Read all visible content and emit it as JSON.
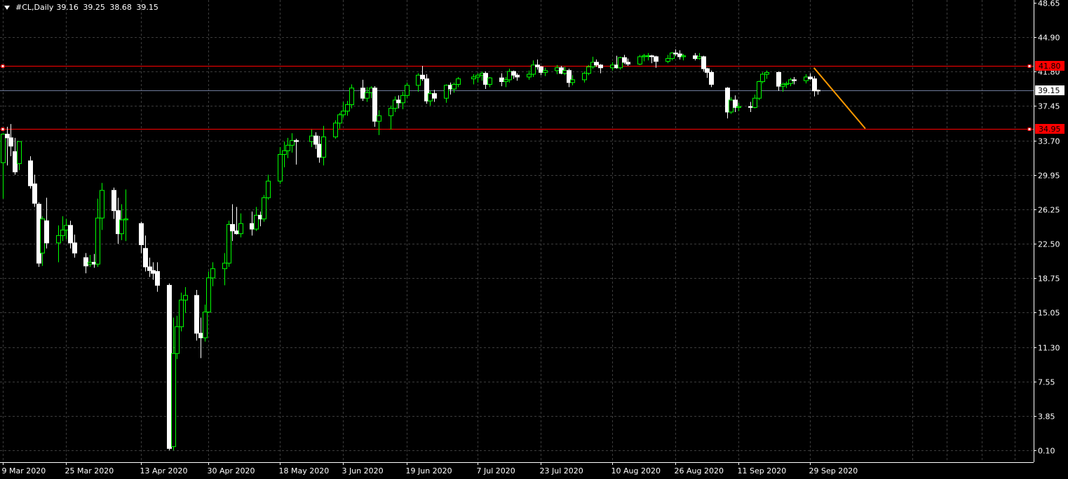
{
  "header": {
    "symbol": "#CL,Daily",
    "open": "39.16",
    "high": "39.25",
    "low": "38.68",
    "close": "39.15"
  },
  "colors": {
    "background": "#000000",
    "grid": "#3c3c3c",
    "axis": "#ffffff",
    "bull_body": "#000000",
    "bull_outline": "#00ff00",
    "bear_body": "#ffffff",
    "resistance_line": "#ff0000",
    "price_line": "#6e7a9a",
    "trend_line": "#ff9900"
  },
  "chart_data": {
    "type": "candlestick",
    "y_ticks": [
      "48.65",
      "44.90",
      "41.80",
      "37.45",
      "33.70",
      "29.95",
      "26.25",
      "22.50",
      "18.75",
      "15.05",
      "11.30",
      "7.55",
      "3.85",
      "0.10"
    ],
    "y_range": [
      0.1,
      48.65
    ],
    "x_labels": [
      "9 Mar 2020",
      "25 Mar 2020",
      "13 Apr 2020",
      "30 Apr 2020",
      "18 May 2020",
      "3 Jun 2020",
      "19 Jun 2020",
      "7 Jul 2020",
      "23 Jul 2020",
      "10 Aug 2020",
      "26 Aug 2020",
      "11 Sep 2020",
      "29 Sep 2020"
    ],
    "horizontal_lines": [
      {
        "value": 41.8,
        "label": "41.80",
        "color": "#ff0000"
      },
      {
        "value": 34.95,
        "label": "34.95",
        "color": "#ff0000"
      }
    ],
    "current_price": {
      "value": 39.15,
      "label": "39.15"
    },
    "trend_line": {
      "from_date": "30 Sep 2020",
      "from_value": 41.6,
      "to_date": "13 Oct 2020",
      "to_value": 35.0
    },
    "candles": [
      {
        "d": "9 Mar 2020",
        "o": 31.3,
        "h": 34.5,
        "l": 27.4,
        "c": 34.4
      },
      {
        "d": "10 Mar 2020",
        "o": 34.4,
        "h": 35.2,
        "l": 31.0,
        "c": 34.0
      },
      {
        "d": "11 Mar 2020",
        "o": 34.0,
        "h": 35.5,
        "l": 32.0,
        "c": 33.1
      },
      {
        "d": "12 Mar 2020",
        "o": 32.5,
        "h": 34.0,
        "l": 30.0,
        "c": 30.3
      },
      {
        "d": "13 Mar 2020",
        "o": 31.2,
        "h": 33.5,
        "l": 30.5,
        "c": 33.6
      },
      {
        "d": "16 Mar 2020",
        "o": 31.5,
        "h": 32.0,
        "l": 28.5,
        "c": 28.8
      },
      {
        "d": "17 Mar 2020",
        "o": 29.0,
        "h": 30.0,
        "l": 26.5,
        "c": 26.9
      },
      {
        "d": "18 Mar 2020",
        "o": 26.8,
        "h": 27.0,
        "l": 20.0,
        "c": 20.4
      },
      {
        "d": "19 Mar 2020",
        "o": 21.5,
        "h": 25.5,
        "l": 20.1,
        "c": 25.2
      },
      {
        "d": "20 Mar 2020",
        "o": 25.0,
        "h": 27.5,
        "l": 22.0,
        "c": 22.6
      },
      {
        "d": "23 Mar 2020",
        "o": 22.6,
        "h": 24.5,
        "l": 20.5,
        "c": 23.4
      },
      {
        "d": "24 Mar 2020",
        "o": 23.4,
        "h": 25.5,
        "l": 22.8,
        "c": 24.0
      },
      {
        "d": "25 Mar 2020",
        "o": 24.0,
        "h": 25.2,
        "l": 23.0,
        "c": 24.5
      },
      {
        "d": "26 Mar 2020",
        "o": 24.5,
        "h": 25.0,
        "l": 22.0,
        "c": 22.6
      },
      {
        "d": "27 Mar 2020",
        "o": 22.6,
        "h": 23.5,
        "l": 21.0,
        "c": 21.5
      },
      {
        "d": "30 Mar 2020",
        "o": 21.0,
        "h": 21.5,
        "l": 19.3,
        "c": 20.1
      },
      {
        "d": "31 Mar 2020",
        "o": 20.3,
        "h": 21.3,
        "l": 20.0,
        "c": 20.5
      },
      {
        "d": "1 Apr 2020",
        "o": 20.5,
        "h": 21.4,
        "l": 19.9,
        "c": 20.3
      },
      {
        "d": "2 Apr 2020",
        "o": 20.3,
        "h": 27.4,
        "l": 20.0,
        "c": 25.3
      },
      {
        "d": "3 Apr 2020",
        "o": 25.3,
        "h": 29.1,
        "l": 24.0,
        "c": 28.3
      },
      {
        "d": "6 Apr 2020",
        "o": 28.3,
        "h": 28.6,
        "l": 25.2,
        "c": 26.1
      },
      {
        "d": "7 Apr 2020",
        "o": 26.1,
        "h": 27.5,
        "l": 22.5,
        "c": 23.6
      },
      {
        "d": "8 Apr 2020",
        "o": 23.6,
        "h": 26.8,
        "l": 22.9,
        "c": 25.1
      },
      {
        "d": "9 Apr 2020",
        "o": 25.1,
        "h": 28.4,
        "l": 22.8,
        "c": 25.2
      },
      {
        "d": "13 Apr 2020",
        "o": 24.7,
        "h": 24.9,
        "l": 21.5,
        "c": 22.4
      },
      {
        "d": "14 Apr 2020",
        "o": 22.0,
        "h": 23.4,
        "l": 19.5,
        "c": 20.0
      },
      {
        "d": "15 Apr 2020",
        "o": 20.0,
        "h": 21.0,
        "l": 18.9,
        "c": 19.6
      },
      {
        "d": "16 Apr 2020",
        "o": 19.6,
        "h": 20.5,
        "l": 18.6,
        "c": 19.3
      },
      {
        "d": "17 Apr 2020",
        "o": 19.5,
        "h": 20.5,
        "l": 17.3,
        "c": 18.0
      },
      {
        "d": "20 Apr 2020",
        "o": 18.0,
        "h": 18.2,
        "l": 0.1,
        "c": 0.3
      },
      {
        "d": "21 Apr 2020",
        "o": 0.5,
        "h": 14.5,
        "l": 0.1,
        "c": 10.6
      },
      {
        "d": "22 Apr 2020",
        "o": 10.6,
        "h": 14.7,
        "l": 10.0,
        "c": 13.5
      },
      {
        "d": "23 Apr 2020",
        "o": 13.5,
        "h": 17.2,
        "l": 13.0,
        "c": 16.4
      },
      {
        "d": "24 Apr 2020",
        "o": 16.4,
        "h": 17.8,
        "l": 15.0,
        "c": 16.9
      },
      {
        "d": "27 Apr 2020",
        "o": 16.9,
        "h": 17.5,
        "l": 12.0,
        "c": 12.8
      },
      {
        "d": "28 Apr 2020",
        "o": 12.8,
        "h": 14.5,
        "l": 10.1,
        "c": 12.3
      },
      {
        "d": "29 Apr 2020",
        "o": 12.3,
        "h": 15.9,
        "l": 11.9,
        "c": 15.1
      },
      {
        "d": "30 Apr 2020",
        "o": 15.1,
        "h": 19.5,
        "l": 15.0,
        "c": 18.8
      },
      {
        "d": "1 May 2020",
        "o": 18.8,
        "h": 20.5,
        "l": 17.9,
        "c": 19.8
      },
      {
        "d": "4 May 2020",
        "o": 19.8,
        "h": 21.5,
        "l": 18.0,
        "c": 20.4
      },
      {
        "d": "5 May 2020",
        "o": 20.4,
        "h": 25.0,
        "l": 20.0,
        "c": 24.6
      },
      {
        "d": "6 May 2020",
        "o": 24.6,
        "h": 26.8,
        "l": 22.8,
        "c": 23.9
      },
      {
        "d": "7 May 2020",
        "o": 23.9,
        "h": 26.5,
        "l": 23.5,
        "c": 23.6
      },
      {
        "d": "8 May 2020",
        "o": 23.6,
        "h": 25.8,
        "l": 23.2,
        "c": 24.7
      },
      {
        "d": "11 May 2020",
        "o": 24.7,
        "h": 26.0,
        "l": 23.4,
        "c": 24.1
      },
      {
        "d": "12 May 2020",
        "o": 24.1,
        "h": 26.5,
        "l": 23.9,
        "c": 25.6
      },
      {
        "d": "13 May 2020",
        "o": 25.6,
        "h": 26.0,
        "l": 24.4,
        "c": 25.2
      },
      {
        "d": "14 May 2020",
        "o": 25.2,
        "h": 27.8,
        "l": 24.9,
        "c": 27.5
      },
      {
        "d": "15 May 2020",
        "o": 27.5,
        "h": 30.0,
        "l": 27.3,
        "c": 29.3
      },
      {
        "d": "18 May 2020",
        "o": 29.3,
        "h": 33.0,
        "l": 29.0,
        "c": 32.2
      },
      {
        "d": "19 May 2020",
        "o": 32.2,
        "h": 33.6,
        "l": 30.8,
        "c": 32.6
      },
      {
        "d": "20 May 2020",
        "o": 32.6,
        "h": 34.0,
        "l": 31.8,
        "c": 33.2
      },
      {
        "d": "21 May 2020",
        "o": 33.2,
        "h": 34.5,
        "l": 32.4,
        "c": 33.7
      },
      {
        "d": "22 May 2020",
        "o": 33.7,
        "h": 33.9,
        "l": 31.1,
        "c": 33.6
      },
      {
        "d": "26 May 2020",
        "o": 33.6,
        "h": 34.9,
        "l": 33.0,
        "c": 34.2
      },
      {
        "d": "27 May 2020",
        "o": 34.2,
        "h": 34.6,
        "l": 32.8,
        "c": 33.3
      },
      {
        "d": "28 May 2020",
        "o": 33.3,
        "h": 34.2,
        "l": 31.3,
        "c": 31.9
      },
      {
        "d": "29 May 2020",
        "o": 31.9,
        "h": 35.3,
        "l": 31.0,
        "c": 34.1
      },
      {
        "d": "1 Jun 2020",
        "o": 34.1,
        "h": 35.9,
        "l": 33.9,
        "c": 35.6
      },
      {
        "d": "2 Jun 2020",
        "o": 35.6,
        "h": 36.7,
        "l": 35.0,
        "c": 36.5
      },
      {
        "d": "3 Jun 2020",
        "o": 36.5,
        "h": 37.9,
        "l": 36.2,
        "c": 36.9
      },
      {
        "d": "4 Jun 2020",
        "o": 36.9,
        "h": 38.0,
        "l": 36.4,
        "c": 37.6
      },
      {
        "d": "5 Jun 2020",
        "o": 37.6,
        "h": 39.8,
        "l": 37.2,
        "c": 39.4
      },
      {
        "d": "8 Jun 2020",
        "o": 39.4,
        "h": 40.3,
        "l": 38.0,
        "c": 38.3
      },
      {
        "d": "9 Jun 2020",
        "o": 38.3,
        "h": 39.5,
        "l": 37.9,
        "c": 38.9
      },
      {
        "d": "10 Jun 2020",
        "o": 38.9,
        "h": 39.6,
        "l": 38.3,
        "c": 39.4
      },
      {
        "d": "11 Jun 2020",
        "o": 39.4,
        "h": 39.6,
        "l": 35.2,
        "c": 35.8
      },
      {
        "d": "12 Jun 2020",
        "o": 35.8,
        "h": 37.0,
        "l": 34.3,
        "c": 36.4
      },
      {
        "d": "15 Jun 2020",
        "o": 36.4,
        "h": 37.5,
        "l": 34.9,
        "c": 37.2
      },
      {
        "d": "16 Jun 2020",
        "o": 37.2,
        "h": 38.5,
        "l": 36.8,
        "c": 38.1
      },
      {
        "d": "17 Jun 2020",
        "o": 38.1,
        "h": 38.6,
        "l": 37.2,
        "c": 37.8
      },
      {
        "d": "18 Jun 2020",
        "o": 37.8,
        "h": 39.0,
        "l": 37.1,
        "c": 38.6
      },
      {
        "d": "19 Jun 2020",
        "o": 38.6,
        "h": 40.0,
        "l": 38.3,
        "c": 39.7
      },
      {
        "d": "22 Jun 2020",
        "o": 39.7,
        "h": 41.0,
        "l": 39.0,
        "c": 40.8
      },
      {
        "d": "23 Jun 2020",
        "o": 40.8,
        "h": 41.8,
        "l": 40.2,
        "c": 40.4
      },
      {
        "d": "24 Jun 2020",
        "o": 40.4,
        "h": 40.9,
        "l": 37.7,
        "c": 38.0
      },
      {
        "d": "25 Jun 2020",
        "o": 38.0,
        "h": 39.1,
        "l": 37.5,
        "c": 38.8
      },
      {
        "d": "26 Jun 2020",
        "o": 38.8,
        "h": 39.2,
        "l": 37.9,
        "c": 38.3
      },
      {
        "d": "29 Jun 2020",
        "o": 38.3,
        "h": 39.8,
        "l": 37.8,
        "c": 39.7
      },
      {
        "d": "30 Jun 2020",
        "o": 39.7,
        "h": 40.0,
        "l": 38.7,
        "c": 39.3
      },
      {
        "d": "1 Jul 2020",
        "o": 39.3,
        "h": 40.0,
        "l": 38.9,
        "c": 39.8
      },
      {
        "d": "2 Jul 2020",
        "o": 39.8,
        "h": 40.6,
        "l": 39.5,
        "c": 40.4
      },
      {
        "d": "6 Jul 2020",
        "o": 40.4,
        "h": 40.9,
        "l": 39.8,
        "c": 40.6
      },
      {
        "d": "7 Jul 2020",
        "o": 40.6,
        "h": 41.0,
        "l": 40.0,
        "c": 40.8
      },
      {
        "d": "8 Jul 2020",
        "o": 40.8,
        "h": 41.2,
        "l": 40.2,
        "c": 41.0
      },
      {
        "d": "9 Jul 2020",
        "o": 41.0,
        "h": 41.2,
        "l": 39.3,
        "c": 39.8
      },
      {
        "d": "10 Jul 2020",
        "o": 39.8,
        "h": 40.6,
        "l": 39.5,
        "c": 40.5
      },
      {
        "d": "13 Jul 2020",
        "o": 40.5,
        "h": 41.0,
        "l": 39.6,
        "c": 40.1
      },
      {
        "d": "14 Jul 2020",
        "o": 40.1,
        "h": 40.6,
        "l": 39.5,
        "c": 40.3
      },
      {
        "d": "15 Jul 2020",
        "o": 40.3,
        "h": 41.5,
        "l": 40.0,
        "c": 41.2
      },
      {
        "d": "16 Jul 2020",
        "o": 41.2,
        "h": 41.3,
        "l": 40.4,
        "c": 40.8
      },
      {
        "d": "17 Jul 2020",
        "o": 40.8,
        "h": 41.0,
        "l": 40.2,
        "c": 40.6
      },
      {
        "d": "20 Jul 2020",
        "o": 40.6,
        "h": 41.3,
        "l": 40.3,
        "c": 40.9
      },
      {
        "d": "21 Jul 2020",
        "o": 40.9,
        "h": 42.4,
        "l": 40.6,
        "c": 41.9
      },
      {
        "d": "22 Jul 2020",
        "o": 41.9,
        "h": 42.5,
        "l": 41.4,
        "c": 41.7
      },
      {
        "d": "23 Jul 2020",
        "o": 41.7,
        "h": 41.8,
        "l": 40.8,
        "c": 41.1
      },
      {
        "d": "24 Jul 2020",
        "o": 41.1,
        "h": 41.6,
        "l": 40.7,
        "c": 41.3
      },
      {
        "d": "27 Jul 2020",
        "o": 41.3,
        "h": 41.9,
        "l": 40.9,
        "c": 41.6
      },
      {
        "d": "28 Jul 2020",
        "o": 41.6,
        "h": 41.8,
        "l": 40.9,
        "c": 41.0
      },
      {
        "d": "29 Jul 2020",
        "o": 41.0,
        "h": 41.7,
        "l": 40.8,
        "c": 41.3
      },
      {
        "d": "30 Jul 2020",
        "o": 41.3,
        "h": 41.5,
        "l": 39.5,
        "c": 40.0
      },
      {
        "d": "31 Jul 2020",
        "o": 40.0,
        "h": 40.8,
        "l": 39.7,
        "c": 40.3
      },
      {
        "d": "3 Aug 2020",
        "o": 40.3,
        "h": 41.2,
        "l": 40.0,
        "c": 41.0
      },
      {
        "d": "4 Aug 2020",
        "o": 41.0,
        "h": 41.9,
        "l": 40.8,
        "c": 41.7
      },
      {
        "d": "5 Aug 2020",
        "o": 41.7,
        "h": 42.8,
        "l": 41.5,
        "c": 42.2
      },
      {
        "d": "6 Aug 2020",
        "o": 42.2,
        "h": 42.5,
        "l": 41.7,
        "c": 41.9
      },
      {
        "d": "7 Aug 2020",
        "o": 41.9,
        "h": 42.0,
        "l": 41.0,
        "c": 41.6
      },
      {
        "d": "10 Aug 2020",
        "o": 41.6,
        "h": 42.2,
        "l": 41.3,
        "c": 41.9
      },
      {
        "d": "11 Aug 2020",
        "o": 41.9,
        "h": 42.9,
        "l": 41.5,
        "c": 41.6
      },
      {
        "d": "12 Aug 2020",
        "o": 41.6,
        "h": 42.8,
        "l": 41.4,
        "c": 42.7
      },
      {
        "d": "13 Aug 2020",
        "o": 42.7,
        "h": 43.0,
        "l": 42.0,
        "c": 42.2
      },
      {
        "d": "14 Aug 2020",
        "o": 42.2,
        "h": 42.6,
        "l": 41.8,
        "c": 42.0
      },
      {
        "d": "17 Aug 2020",
        "o": 42.0,
        "h": 43.0,
        "l": 41.9,
        "c": 42.8
      },
      {
        "d": "18 Aug 2020",
        "o": 42.8,
        "h": 43.1,
        "l": 42.3,
        "c": 42.9
      },
      {
        "d": "19 Aug 2020",
        "o": 42.9,
        "h": 43.2,
        "l": 42.4,
        "c": 42.9
      },
      {
        "d": "20 Aug 2020",
        "o": 42.9,
        "h": 43.0,
        "l": 42.1,
        "c": 42.8
      },
      {
        "d": "21 Aug 2020",
        "o": 42.8,
        "h": 42.9,
        "l": 41.6,
        "c": 42.3
      },
      {
        "d": "24 Aug 2020",
        "o": 42.3,
        "h": 43.0,
        "l": 42.1,
        "c": 42.6
      },
      {
        "d": "25 Aug 2020",
        "o": 42.6,
        "h": 43.3,
        "l": 42.4,
        "c": 43.2
      },
      {
        "d": "26 Aug 2020",
        "o": 43.2,
        "h": 43.6,
        "l": 42.9,
        "c": 43.1
      },
      {
        "d": "27 Aug 2020",
        "o": 43.1,
        "h": 43.5,
        "l": 42.5,
        "c": 42.8
      },
      {
        "d": "28 Aug 2020",
        "o": 42.8,
        "h": 43.1,
        "l": 42.4,
        "c": 42.9
      },
      {
        "d": "31 Aug 2020",
        "o": 42.9,
        "h": 43.2,
        "l": 42.4,
        "c": 42.6
      },
      {
        "d": "1 Sep 2020",
        "o": 42.6,
        "h": 43.2,
        "l": 42.5,
        "c": 42.8
      },
      {
        "d": "2 Sep 2020",
        "o": 42.8,
        "h": 42.9,
        "l": 41.2,
        "c": 41.5
      },
      {
        "d": "3 Sep 2020",
        "o": 41.5,
        "h": 41.6,
        "l": 40.5,
        "c": 41.1
      },
      {
        "d": "4 Sep 2020",
        "o": 41.1,
        "h": 41.3,
        "l": 39.5,
        "c": 39.8
      },
      {
        "d": "8 Sep 2020",
        "o": 39.4,
        "h": 39.5,
        "l": 36.1,
        "c": 36.8
      },
      {
        "d": "9 Sep 2020",
        "o": 36.8,
        "h": 38.4,
        "l": 36.6,
        "c": 38.1
      },
      {
        "d": "10 Sep 2020",
        "o": 38.1,
        "h": 38.6,
        "l": 36.8,
        "c": 37.3
      },
      {
        "d": "11 Sep 2020",
        "o": 37.3,
        "h": 37.8,
        "l": 36.9,
        "c": 37.4
      },
      {
        "d": "14 Sep 2020",
        "o": 37.4,
        "h": 37.9,
        "l": 36.8,
        "c": 37.3
      },
      {
        "d": "15 Sep 2020",
        "o": 37.3,
        "h": 38.7,
        "l": 37.2,
        "c": 38.3
      },
      {
        "d": "16 Sep 2020",
        "o": 38.3,
        "h": 40.2,
        "l": 38.1,
        "c": 40.1
      },
      {
        "d": "17 Sep 2020",
        "o": 40.1,
        "h": 41.1,
        "l": 39.9,
        "c": 40.9
      },
      {
        "d": "18 Sep 2020",
        "o": 40.9,
        "h": 41.3,
        "l": 40.4,
        "c": 41.1
      },
      {
        "d": "21 Sep 2020",
        "o": 41.1,
        "h": 41.2,
        "l": 39.1,
        "c": 39.6
      },
      {
        "d": "22 Sep 2020",
        "o": 39.6,
        "h": 40.0,
        "l": 39.0,
        "c": 39.8
      },
      {
        "d": "23 Sep 2020",
        "o": 39.8,
        "h": 40.1,
        "l": 39.4,
        "c": 39.9
      },
      {
        "d": "24 Sep 2020",
        "o": 39.9,
        "h": 40.5,
        "l": 39.6,
        "c": 40.3
      },
      {
        "d": "25 Sep 2020",
        "o": 40.3,
        "h": 40.6,
        "l": 39.8,
        "c": 40.2
      },
      {
        "d": "28 Sep 2020",
        "o": 40.2,
        "h": 40.9,
        "l": 39.9,
        "c": 40.6
      },
      {
        "d": "29 Sep 2020",
        "o": 40.6,
        "h": 41.0,
        "l": 40.3,
        "c": 40.4
      },
      {
        "d": "30 Sep 2020",
        "o": 40.4,
        "h": 40.7,
        "l": 38.5,
        "c": 39.1
      },
      {
        "d": "1 Oct 2020",
        "o": 39.16,
        "h": 39.25,
        "l": 38.68,
        "c": 39.15
      }
    ]
  }
}
